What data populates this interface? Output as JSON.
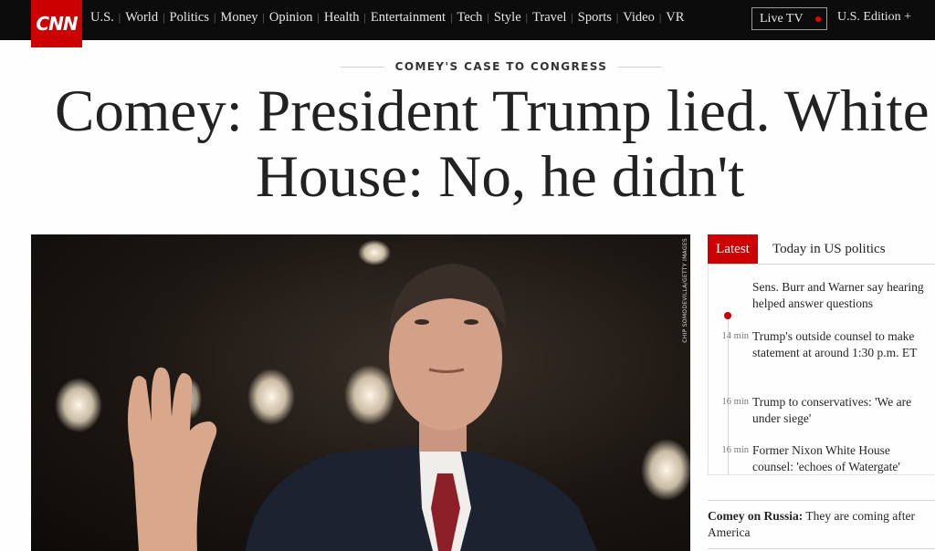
{
  "nav": {
    "logo": "CNN",
    "links": [
      "U.S.",
      "World",
      "Politics",
      "Money",
      "Opinion",
      "Health",
      "Entertainment",
      "Tech",
      "Style",
      "Travel",
      "Sports",
      "Video",
      "VR"
    ],
    "live_tv": "Live TV",
    "edition": "U.S. Edition +"
  },
  "kicker": "COMEY'S CASE TO CONGRESS",
  "headline": {
    "line1": "Comey: President Trump lied. White",
    "line2": "House: No, he didn't"
  },
  "photo": {
    "credit": "CHIP SOMODEVILLA/GETTY IMAGES"
  },
  "side": {
    "tab_latest": "Latest",
    "tab_today": "Today in US politics",
    "feed": [
      {
        "time": "",
        "text": "Sens. Burr and Warner say hearing helped answer questions"
      },
      {
        "time": "14 min",
        "text": "Trump's outside counsel to make statement at around 1:30 p.m. ET"
      },
      {
        "time": "16 min",
        "text": "Trump to conservatives: 'We are under siege'"
      },
      {
        "time": "16 min",
        "text": "Former Nixon White House counsel: 'echoes of Watergate'"
      }
    ],
    "story_bold": "Comey on Russia:",
    "story_text": " They are coming after America"
  },
  "colors": {
    "brand_red": "#cc0000",
    "nav_bg": "#0c0c0c"
  }
}
